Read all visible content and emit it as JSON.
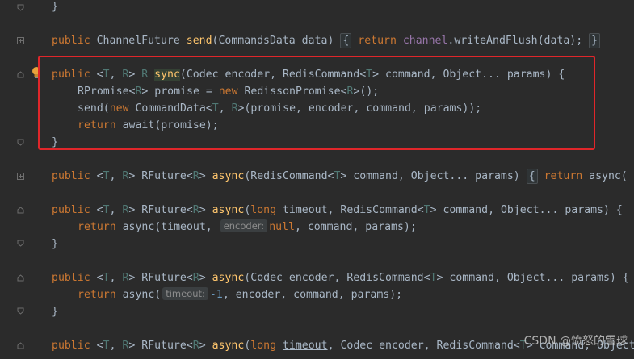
{
  "code": {
    "l1": {
      "brace": "}"
    },
    "l2": {
      "kw_public": "public",
      "type": "ChannelFuture",
      "fn": "send",
      "args": "(CommandsData data)",
      "brace_open": "{",
      "kw_return": "return",
      "field": "channel",
      "call": ".writeAndFlush(data);",
      "brace_close": "}"
    },
    "l3": {
      "kw_public": "public",
      "lt": "<",
      "t": "T",
      "comma": ", ",
      "r": "R",
      "gt": ">",
      "r2": "R",
      "fn": "sync",
      "args1": "(Codec encoder, RedisCommand<",
      "t2": "T",
      "args2": "> command, Object... params) {"
    },
    "l4": {
      "a": "RPromise<",
      "r": "R",
      "b": "> promise = ",
      "kw_new": "new",
      "c": " RedissonPromise<",
      "r2": "R",
      "d": ">();"
    },
    "l5": {
      "a": "send(",
      "kw_new": "new",
      "b": " CommandData<",
      "t": "T",
      "c": ", ",
      "r": "R",
      "d": ">(promise, encoder, command, params));"
    },
    "l6": {
      "kw_return": "return",
      "a": " await(promise);"
    },
    "l7": {
      "brace": "}"
    },
    "l8": {
      "kw_public": "public",
      "lt": "<",
      "t": "T",
      "comma": ", ",
      "r": "R",
      "gt": "> RFuture<",
      "r2": "R",
      "gt2": ">",
      "fn": "async",
      "args1": "(RedisCommand<",
      "t2": "T",
      "args2": "> command, Object... params)",
      "brace_open": "{",
      "kw_return": "return",
      "tail": " async("
    },
    "l9": {
      "kw_public": "public",
      "lt": "<",
      "t": "T",
      "comma": ", ",
      "r": "R",
      "gt": "> RFuture<",
      "r2": "R",
      "gt2": ">",
      "fn": "async",
      "p": "(",
      "kw_long": "long",
      "args1": " timeout, RedisCommand<",
      "t2": "T",
      "args2": "> command, Object... params) {"
    },
    "l10": {
      "kw_return": "return",
      "a": " async(timeout, ",
      "hint": "encoder:",
      "kw_null": "null",
      "b": ", command, params);"
    },
    "l11": {
      "brace": "}"
    },
    "l12": {
      "kw_public": "public",
      "lt": "<",
      "t": "T",
      "comma": ", ",
      "r": "R",
      "gt": "> RFuture<",
      "r2": "R",
      "gt2": ">",
      "fn": "async",
      "args1": "(Codec encoder, RedisCommand<",
      "t2": "T",
      "args2": "> command, Object... params) {"
    },
    "l13": {
      "kw_return": "return",
      "a": " async(",
      "hint": "timeout:",
      "num": "-1",
      "b": ", encoder, command, params);"
    },
    "l14": {
      "brace": "}"
    },
    "l15": {
      "kw_public": "public",
      "lt": "<",
      "t": "T",
      "comma": ", ",
      "r": "R",
      "gt": "> RFuture<",
      "r2": "R",
      "gt2": ">",
      "fn": "async",
      "p": "(",
      "kw_long": "long",
      "sp": " ",
      "timeout": "timeout",
      "args1": ", Codec encoder, RedisCommand<",
      "t2": "T",
      "args2": "> command, Object"
    }
  },
  "watermark": {
    "text": "CSDN @愤怒的雪球"
  },
  "colors": {
    "background": "#2b2b2b",
    "keyword": "#cc7832",
    "function": "#ffc66d",
    "field": "#9876aa",
    "type_param": "#507874",
    "number": "#6897bb",
    "highlight_box": "#e0262a"
  }
}
